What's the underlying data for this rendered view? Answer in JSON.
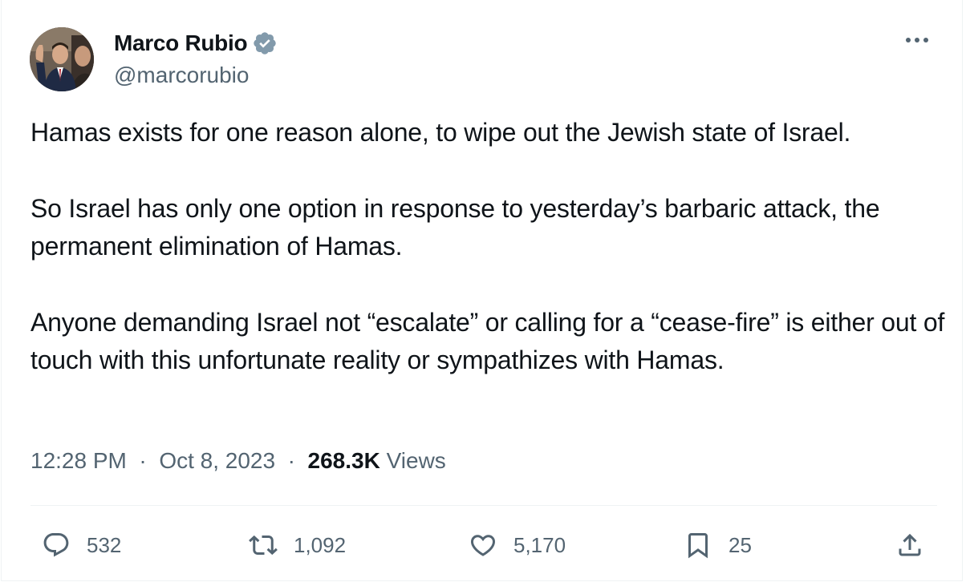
{
  "author": {
    "display_name": "Marco Rubio",
    "handle": "@marcorubio",
    "verified": true,
    "avatar_icon": "profile-photo"
  },
  "tweet": {
    "paragraphs": [
      "Hamas exists for one reason alone, to wipe out the Jewish state of Israel.",
      "So Israel has only one option in response to yesterday’s barbaric attack, the permanent elimination of Hamas.",
      "Anyone demanding Israel not “escalate” or calling for a “cease-fire” is either out of touch with this unfortunate reality or sympathizes with Hamas."
    ]
  },
  "meta": {
    "time": "12:28 PM",
    "separator": "·",
    "date": "Oct 8, 2023",
    "views_count": "268.3K",
    "views_label": "Views"
  },
  "actions": {
    "replies": "532",
    "reposts": "1,092",
    "likes": "5,170",
    "bookmarks": "25"
  },
  "colors": {
    "text": "#0f1419",
    "secondary": "#536471",
    "divider": "#eff3f4",
    "verified_badge": "#829aab"
  }
}
